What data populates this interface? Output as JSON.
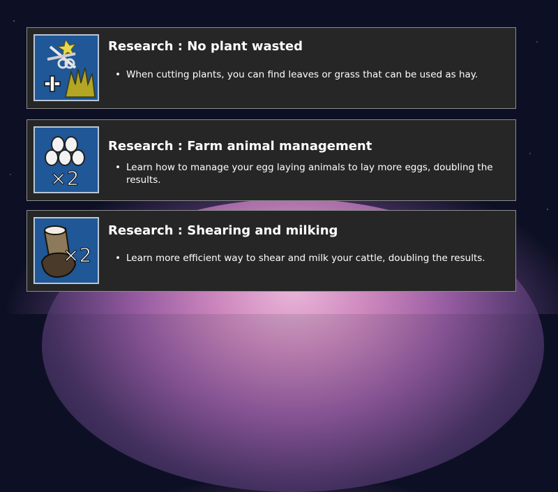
{
  "research_items": [
    {
      "title": "Research : No plant wasted",
      "bullet": "When cutting plants, you can find leaves or grass that can be used as hay.",
      "icon": "scissors-plant-hay-icon"
    },
    {
      "title": "Research : Farm animal management",
      "bullet": "Learn how to manage your egg laying animals to lay more eggs, doubling the results.",
      "icon": "eggs-x2-icon",
      "multiplier": "×2"
    },
    {
      "title": "Research : Shearing and milking",
      "bullet": "Learn more efficient way to shear and milk your cattle, doubling the results.",
      "icon": "milk-bucket-x2-icon",
      "multiplier": "×2"
    }
  ],
  "bullet_glyph": "•",
  "colors": {
    "card_background": "#262626",
    "card_border": "#8d8d8d",
    "icon_background": "#1f5797",
    "text": "#ffffff"
  }
}
